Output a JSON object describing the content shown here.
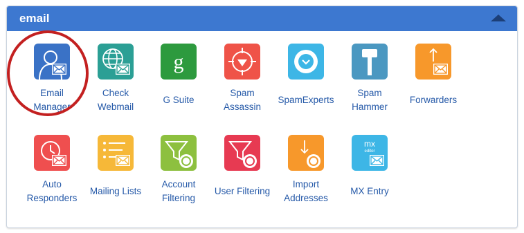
{
  "section": {
    "title": "email"
  },
  "items": [
    {
      "label_lines": [
        "Email",
        "Manager"
      ],
      "icon": "email-manager-icon",
      "color": "#3a72c6"
    },
    {
      "label_lines": [
        "Check",
        "Webmail"
      ],
      "icon": "webmail-globe-icon",
      "color": "#2b9f95"
    },
    {
      "label_lines": [
        "G Suite"
      ],
      "icon": "g-suite-icon",
      "color": "#2d9a3e"
    },
    {
      "label_lines": [
        "Spam",
        "Assassin"
      ],
      "icon": "spam-assassin-icon",
      "color": "#ef5348"
    },
    {
      "label_lines": [
        "SpamExperts"
      ],
      "icon": "spam-experts-icon",
      "color": "#3db6e6"
    },
    {
      "label_lines": [
        "Spam",
        "Hammer"
      ],
      "icon": "spam-hammer-icon",
      "color": "#4b98c1"
    },
    {
      "label_lines": [
        "Forwarders"
      ],
      "icon": "forwarders-icon",
      "color": "#f7982b"
    },
    {
      "label_lines": [
        "Auto",
        "Responders"
      ],
      "icon": "auto-responders-icon",
      "color": "#ef4f4f"
    },
    {
      "label_lines": [
        "Mailing Lists"
      ],
      "icon": "mailing-lists-icon",
      "color": "#f6b838"
    },
    {
      "label_lines": [
        "Account",
        "Filtering"
      ],
      "icon": "account-filtering-icon",
      "color": "#8dc03f"
    },
    {
      "label_lines": [
        "User Filtering"
      ],
      "icon": "user-filtering-icon",
      "color": "#e73a52"
    },
    {
      "label_lines": [
        "Import",
        "Addresses"
      ],
      "icon": "import-addresses-icon",
      "color": "#f7982b"
    },
    {
      "label_lines": [
        "MX Entry"
      ],
      "icon": "mx-entry-icon",
      "color": "#3db6e6"
    }
  ],
  "mx_tile_text": {
    "top": "mx",
    "sub": "editor"
  },
  "highlight": {
    "color": "#c32020"
  }
}
